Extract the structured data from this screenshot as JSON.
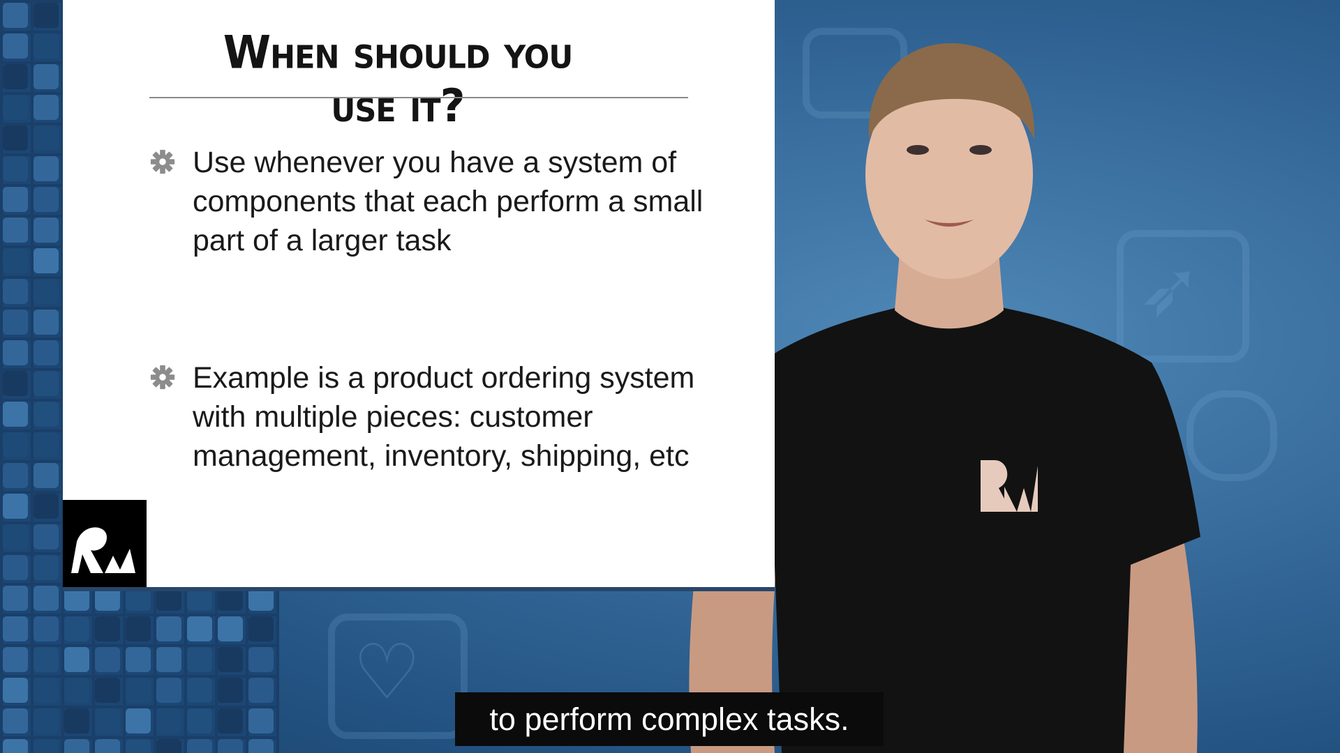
{
  "slide": {
    "title": "When should you use it?",
    "bullets": [
      {
        "icon": "gear-icon",
        "text": "Use whenever you have a system of components that each perform a small part of a larger task"
      },
      {
        "icon": "gear-icon",
        "text": "Example is a product ordering system with multiple pieces: customer management, inventory, shipping, etc"
      }
    ],
    "logo": "RW"
  },
  "presenter": {
    "shirt_logo": "RW"
  },
  "caption": {
    "text": "to perform complex tasks."
  },
  "colors": {
    "background_blue": "#3a6f9f",
    "slide_white": "#ffffff",
    "caption_bg": "#0b0b0b"
  }
}
